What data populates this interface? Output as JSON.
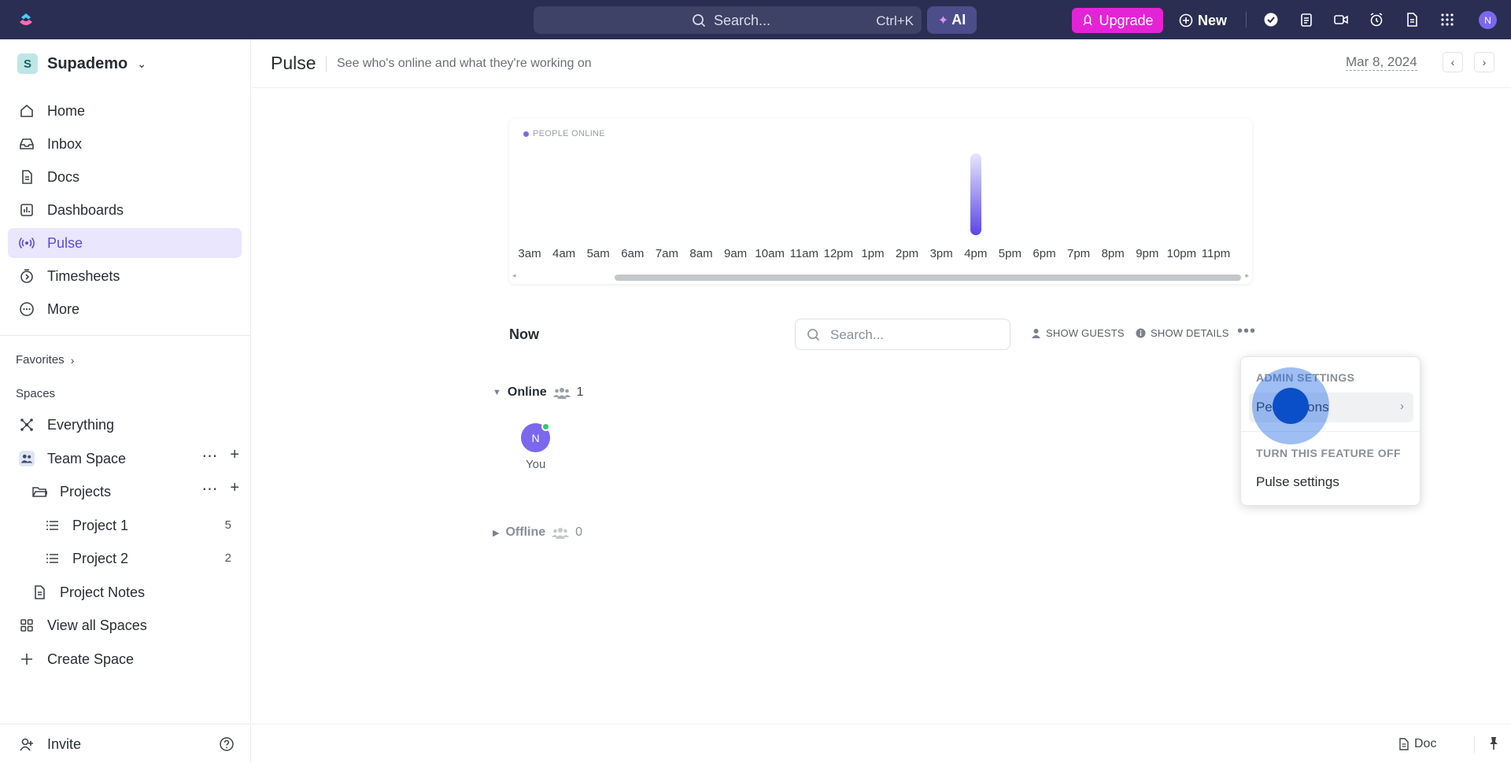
{
  "topbar": {
    "search_text": "Search...",
    "search_shortcut": "Ctrl+K",
    "ai_label": "AI",
    "upgrade_label": "Upgrade",
    "new_label": "New",
    "avatar_initial": "N"
  },
  "sidebar": {
    "workspace_initial": "S",
    "workspace_name": "Supademo",
    "nav": [
      {
        "label": "Home",
        "icon": "home-icon"
      },
      {
        "label": "Inbox",
        "icon": "inbox-icon"
      },
      {
        "label": "Docs",
        "icon": "docs-icon"
      },
      {
        "label": "Dashboards",
        "icon": "dashboards-icon"
      },
      {
        "label": "Pulse",
        "icon": "pulse-icon",
        "active": true
      },
      {
        "label": "Timesheets",
        "icon": "timesheets-icon"
      },
      {
        "label": "More",
        "icon": "more-icon"
      }
    ],
    "favorites_label": "Favorites",
    "spaces_label": "Spaces",
    "everything_label": "Everything",
    "team_space_label": "Team Space",
    "projects_label": "Projects",
    "project1_label": "Project 1",
    "project1_count": "5",
    "project2_label": "Project 2",
    "project2_count": "2",
    "project_notes_label": "Project Notes",
    "view_all_spaces_label": "View all Spaces",
    "create_space_label": "Create Space",
    "invite_label": "Invite"
  },
  "header": {
    "title": "Pulse",
    "subtitle": "See who's online and what they're working on",
    "date": "Mar 8, 2024"
  },
  "chart_data": {
    "type": "bar",
    "title": "",
    "legend": [
      "PEOPLE ONLINE"
    ],
    "categories": [
      "3am",
      "4am",
      "5am",
      "6am",
      "7am",
      "8am",
      "9am",
      "10am",
      "11am",
      "12pm",
      "1pm",
      "2pm",
      "3pm",
      "4pm",
      "5pm",
      "6pm",
      "7pm",
      "8pm",
      "9pm",
      "10pm",
      "11pm"
    ],
    "series": [
      {
        "name": "PEOPLE ONLINE",
        "values": [
          0,
          0,
          0,
          0,
          0,
          0,
          0,
          0,
          0,
          0,
          0,
          0,
          0,
          1,
          0,
          0,
          0,
          0,
          0,
          0,
          0
        ]
      }
    ],
    "ylim": [
      0,
      1
    ],
    "grid": false,
    "color": "#7b68ee"
  },
  "now": {
    "label": "Now",
    "search_placeholder": "Search...",
    "show_guests_label": "SHOW GUESTS",
    "show_details_label": "SHOW DETAILS",
    "online_label": "Online",
    "online_count": "1",
    "offline_label": "Offline",
    "offline_count": "0",
    "user_initial": "N",
    "user_name": "You"
  },
  "dropdown": {
    "admin_header": "ADMIN SETTINGS",
    "permissions_label": "Permissions",
    "turn_off_header": "TURN THIS FEATURE OFF",
    "pulse_settings_label": "Pulse settings"
  },
  "footer": {
    "doc_label": "Doc"
  }
}
